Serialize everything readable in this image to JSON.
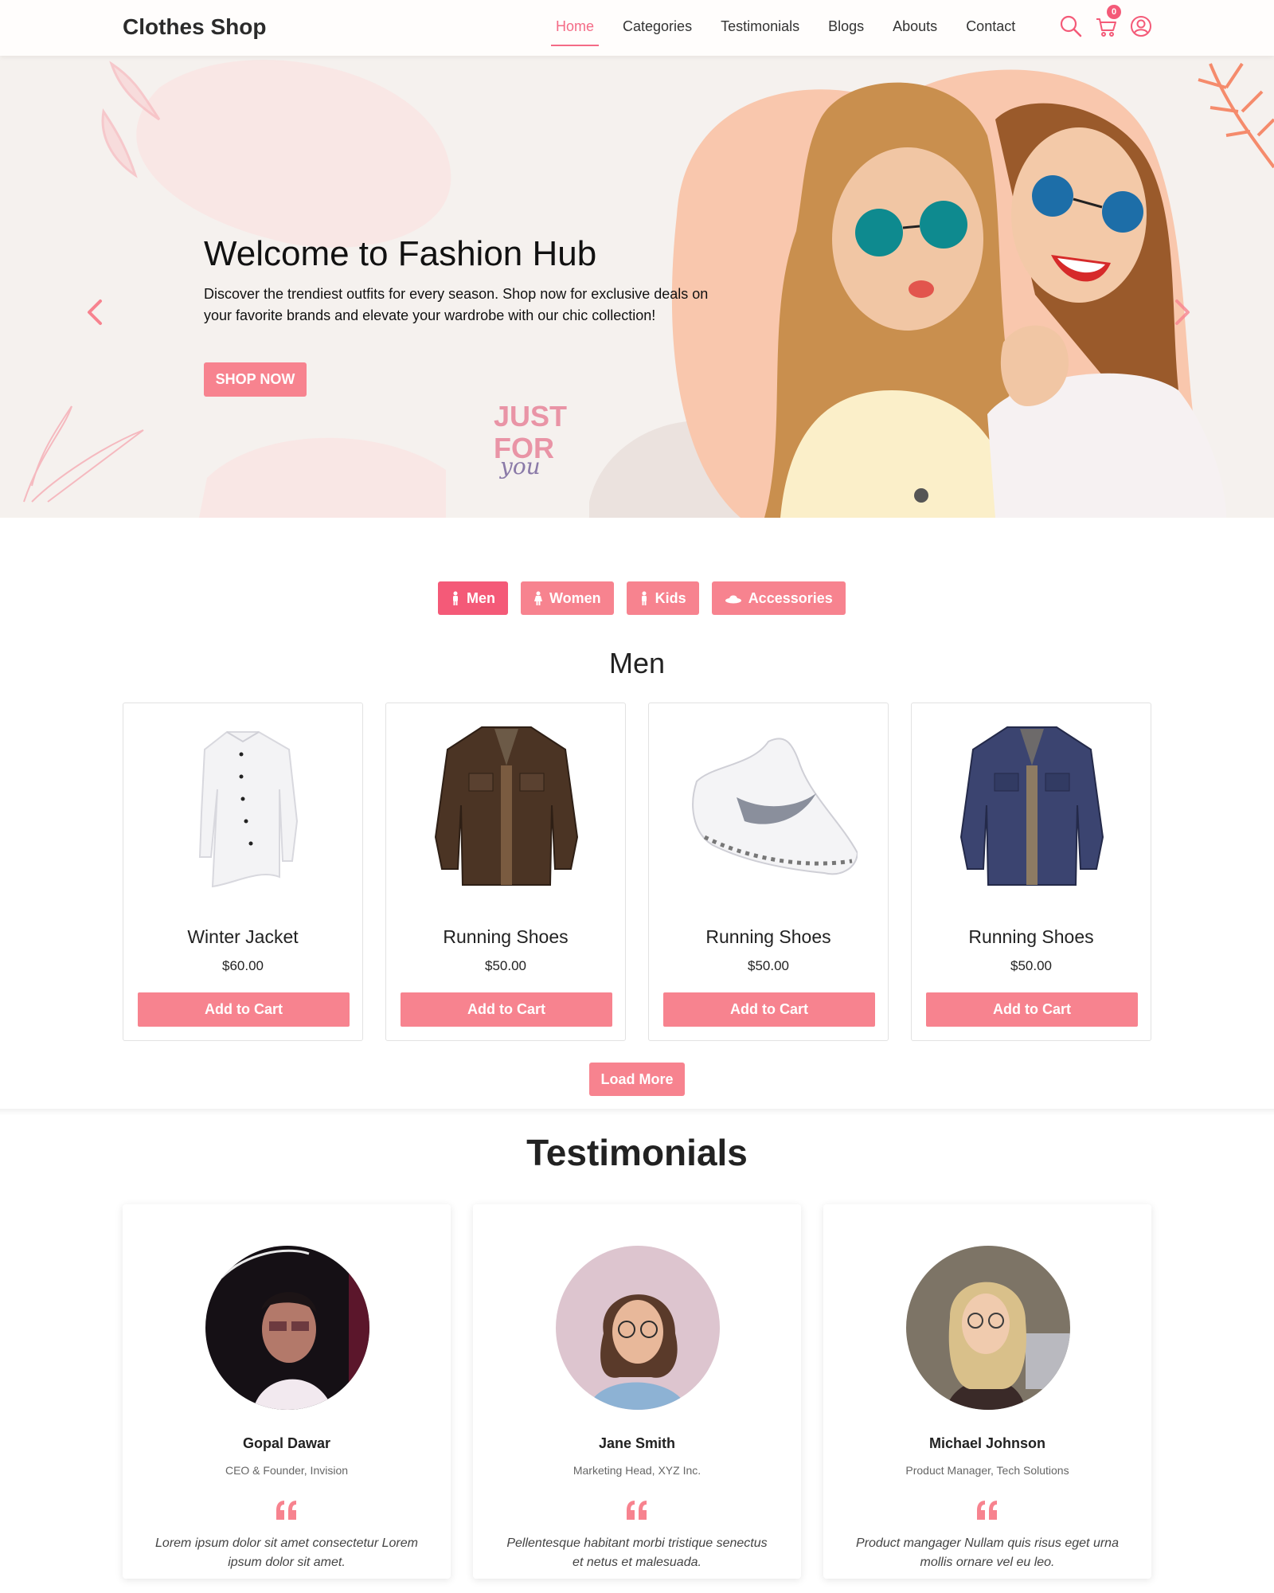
{
  "nav": {
    "brand": "Clothes Shop",
    "links": [
      "Home",
      "Categories",
      "Testimonials",
      "Blogs",
      "Abouts",
      "Contact"
    ],
    "active": "Home",
    "cart_count": "0",
    "icons": [
      "search-icon",
      "cart-icon",
      "user-icon"
    ]
  },
  "hero": {
    "title": "Welcome to Fashion Hub",
    "text": "Discover the trendiest outfits for every season. Shop now for exclusive deals on your favorite brands and elevate your wardrobe with our chic collection!",
    "button": "SHOP NOW",
    "badge_lines": [
      "JUST",
      "FOR",
      "you"
    ],
    "slide_count": 3,
    "active_slide": 1
  },
  "categories": {
    "tabs": [
      {
        "label": "Men",
        "icon": "male-icon"
      },
      {
        "label": "Women",
        "icon": "female-icon"
      },
      {
        "label": "Kids",
        "icon": "child-icon"
      },
      {
        "label": "Accessories",
        "icon": "hat-icon"
      }
    ],
    "active": "Men",
    "section_title": "Men"
  },
  "products": [
    {
      "name": "Winter Jacket",
      "price": "$60.00",
      "button": "Add to Cart",
      "image": "white-shirt"
    },
    {
      "name": "Running Shoes",
      "price": "$50.00",
      "button": "Add to Cart",
      "image": "brown-jacket"
    },
    {
      "name": "Running Shoes",
      "price": "$50.00",
      "button": "Add to Cart",
      "image": "white-sneaker"
    },
    {
      "name": "Running Shoes",
      "price": "$50.00",
      "button": "Add to Cart",
      "image": "navy-jacket"
    }
  ],
  "load_more": "Load More",
  "testimonials": {
    "title": "Testimonials",
    "items": [
      {
        "name": "Gopal Dawar",
        "role": "CEO & Founder, Invision",
        "quote": "Lorem ipsum dolor sit amet consectetur Lorem ipsum dolor sit amet."
      },
      {
        "name": "Jane Smith",
        "role": "Marketing Head, XYZ Inc.",
        "quote": "Pellentesque habitant morbi tristique senectus et netus et malesuada."
      },
      {
        "name": "Michael Johnson",
        "role": "Product Manager, Tech Solutions",
        "quote": "Product mangager Nullam quis risus eget urna mollis ornare vel eu leo."
      }
    ]
  },
  "colors": {
    "accent": "#f45a78",
    "button": "#f7838f",
    "hero_bg": "#f5f1ee",
    "peach": "#f9c7ad"
  }
}
